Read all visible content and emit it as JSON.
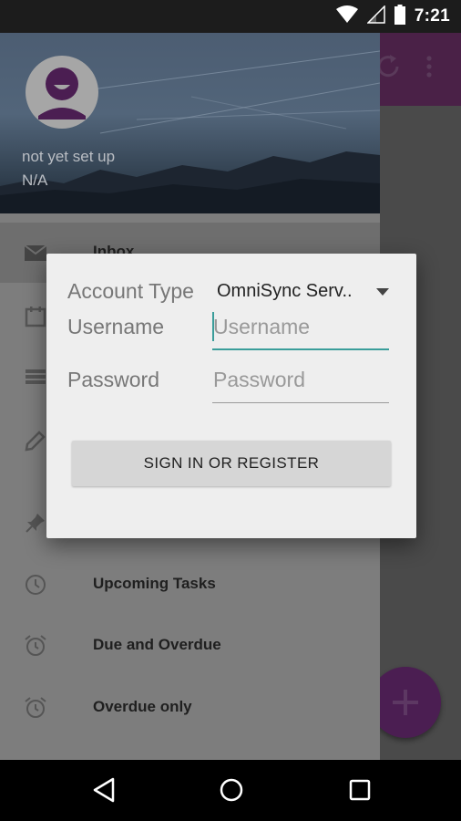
{
  "status_bar": {
    "time": "7:21"
  },
  "drawer": {
    "account_name": "not yet set up",
    "account_email": "N/A",
    "items": [
      {
        "label": "Inbox",
        "icon": "mail-icon"
      },
      {
        "label": "",
        "icon": "calendar-icon"
      },
      {
        "label": "",
        "icon": "list-icon"
      },
      {
        "label": "",
        "icon": "edit-icon"
      },
      {
        "label": "",
        "icon": "pin-icon"
      },
      {
        "label": "Upcoming Tasks",
        "icon": "clock-icon"
      },
      {
        "label": "Due and Overdue",
        "icon": "alarm-icon"
      },
      {
        "label": "Overdue only",
        "icon": "alarm-icon"
      }
    ]
  },
  "dialog": {
    "account_type_label": "Account Type",
    "account_type_value": "OmniSync Serv..",
    "username_label": "Username",
    "username_placeholder": "Username",
    "password_label": "Password",
    "password_placeholder": "Password",
    "submit_label": "SIGN IN OR REGISTER"
  },
  "colors": {
    "accent": "#3a9d9a",
    "primary_dark": "#4a2147"
  }
}
